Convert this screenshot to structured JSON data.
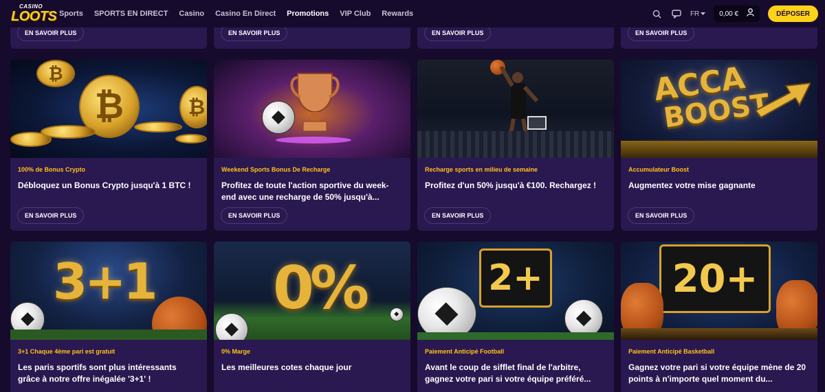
{
  "header": {
    "logo_top": "CASINO",
    "logo_main": "LOOTS",
    "nav": [
      {
        "label": "Sports",
        "active": false
      },
      {
        "label": "SPORTS EN DIRECT",
        "active": false
      },
      {
        "label": "Casino",
        "active": false
      },
      {
        "label": "Casino En Direct",
        "active": false
      },
      {
        "label": "Promotions",
        "active": true
      },
      {
        "label": "VIP Club",
        "active": false
      },
      {
        "label": "Rewards",
        "active": false
      }
    ],
    "language": "FR",
    "balance": "0,00 €",
    "deposit_label": "DÉPOSER"
  },
  "more_label": "EN SAVOIR PLUS",
  "cards": [
    {
      "category": "100% de Bonus Crypto",
      "title": "Débloquez un Bonus Crypto jusqu'à 1 BTC !"
    },
    {
      "category": "Weekend Sports Bonus De Recharge",
      "title": "Profitez de toute l'action sportive du week-end avec une recharge de 50% jusqu'à..."
    },
    {
      "category": "Recharge sports en milieu de semaine",
      "title": "Profitez d'un 50% jusqu'à €100. Rechargez !"
    },
    {
      "category": "Accumulateur Boost",
      "title": "Augmentez votre mise gagnante"
    },
    {
      "category": "3+1 Chaque 4ème pari est gratuit",
      "title": "Les paris sportifs sont plus intéressants grâce à notre offre inégalée '3+1' !"
    },
    {
      "category": "0% Marge",
      "title": "Les meilleures cotes chaque jour"
    },
    {
      "category": "Paiement Anticipé Football",
      "title": "Avant le coup de sifflet final de l'arbitre, gagnez votre pari si votre équipe préféré..."
    },
    {
      "category": "Paiement Anticipé Basketball",
      "title": "Gagnez votre pari si votre équipe mène de 20 points à n'importe quel moment du..."
    }
  ],
  "image_texts": {
    "acca_1": "ACCA",
    "acca_2": "BOOST",
    "three_plus_one": "3+1",
    "zero_percent": "0%",
    "two_plus": "2+",
    "twenty_plus": "20+"
  },
  "colors": {
    "background": "#160b2c",
    "card": "#2a1850",
    "accent": "#ffd21a",
    "category": "#ffc21a"
  }
}
